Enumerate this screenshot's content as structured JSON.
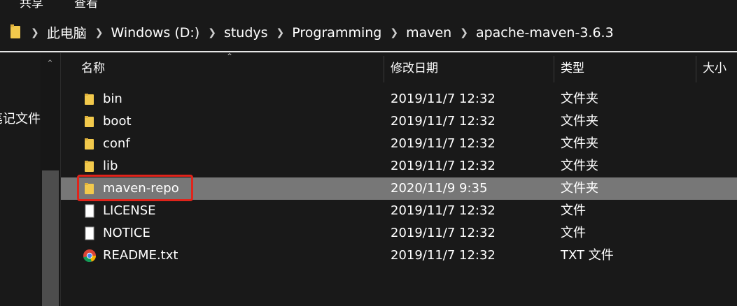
{
  "top_menu": {
    "partial_left": "共享",
    "partial_right": "查看"
  },
  "breadcrumb": [
    "此电脑",
    "Windows (D:)",
    "studys",
    "Programming",
    "maven",
    "apache-maven-3.6.3"
  ],
  "sidebar": {
    "item_label": "笔记文件"
  },
  "columns": {
    "name": "名称",
    "modified": "修改日期",
    "type": "类型",
    "size": "大小"
  },
  "files": [
    {
      "name": "bin",
      "modified": "2019/11/7 12:32",
      "type": "文件夹",
      "icon": "folder-icon"
    },
    {
      "name": "boot",
      "modified": "2019/11/7 12:32",
      "type": "文件夹",
      "icon": "folder-icon"
    },
    {
      "name": "conf",
      "modified": "2019/11/7 12:32",
      "type": "文件夹",
      "icon": "folder-icon"
    },
    {
      "name": "lib",
      "modified": "2019/11/7 12:32",
      "type": "文件夹",
      "icon": "folder-icon"
    },
    {
      "name": "maven-repo",
      "modified": "2020/11/9 9:35",
      "type": "文件夹",
      "icon": "folder-icon",
      "selected": true
    },
    {
      "name": "LICENSE",
      "modified": "2019/11/7 12:32",
      "type": "文件",
      "icon": "file-icon"
    },
    {
      "name": "NOTICE",
      "modified": "2019/11/7 12:32",
      "type": "文件",
      "icon": "file-icon"
    },
    {
      "name": "README.txt",
      "modified": "2019/11/7 12:32",
      "type": "TXT 文件",
      "icon": "chrome-icon"
    }
  ],
  "colors": {
    "background": "#191919",
    "selected_row": "#777777",
    "highlight": "#e0241b",
    "folder": "#f2c94c"
  }
}
